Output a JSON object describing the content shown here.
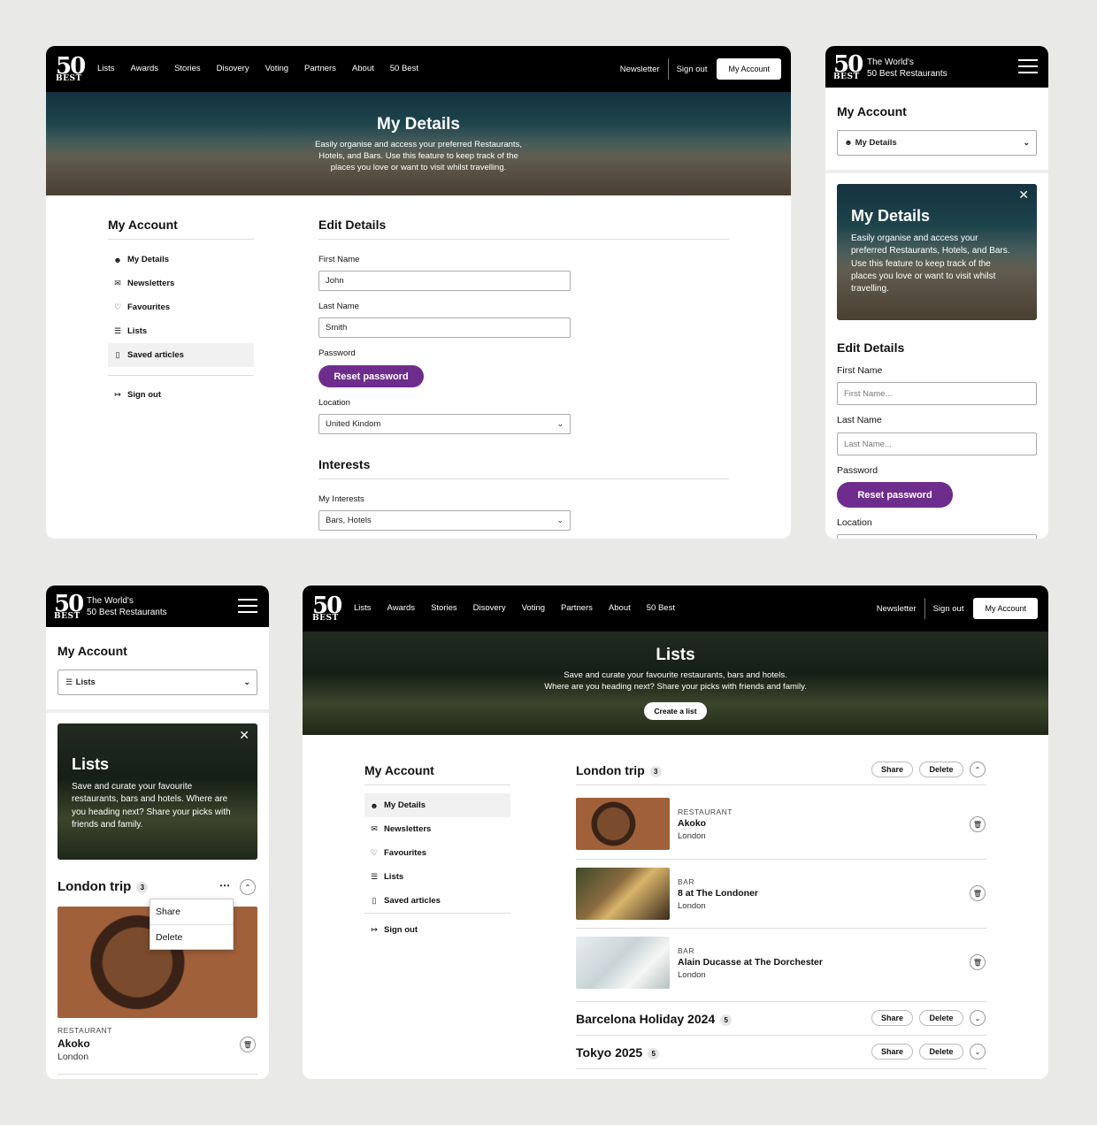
{
  "brand": {
    "fifty": "50",
    "best": "BEST",
    "name_line1": "The World's",
    "name_line2": "50 Best Restaurants"
  },
  "nav": {
    "links": [
      "Lists",
      "Awards",
      "Stories",
      "Disovery",
      "Voting",
      "Partners",
      "About",
      "50 Best"
    ],
    "newsletter": "Newsletter",
    "signout": "Sign out",
    "account": "My Account"
  },
  "sidebar": {
    "title": "My Account",
    "items": [
      {
        "label": "My Details",
        "icon": "user-icon"
      },
      {
        "label": "Newsletters",
        "icon": "mail-icon"
      },
      {
        "label": "Favourites",
        "icon": "heart-icon"
      },
      {
        "label": "Lists",
        "icon": "list-icon"
      },
      {
        "label": "Saved articles",
        "icon": "bookmark-icon"
      }
    ],
    "signout": "Sign out"
  },
  "details": {
    "hero_title": "My Details",
    "hero_text_1": "Easily organise and access your preferred Restaurants,",
    "hero_text_2": "Hotels, and Bars. Use this feature to keep track of the",
    "hero_text_3": "places you love or want to visit whilst travelling.",
    "mobile_hero_lines": [
      "Easily organise and access your",
      "preferred Restaurants, Hotels, and Bars.",
      "Use this feature to keep track of the",
      "places you love or want to visit whilst",
      "travelling."
    ],
    "edit_title": "Edit Details",
    "first_name_label": "First Name",
    "first_name_value": "John",
    "first_name_placeholder": "First Name...",
    "last_name_label": "Last Name",
    "last_name_value": "Smith",
    "last_name_placeholder": "Last Name...",
    "password_label": "Password",
    "reset_button": "Reset password",
    "location_label": "Location",
    "location_value": "United Kindom",
    "interests_title": "Interests",
    "my_interests_label": "My Interests",
    "my_interests_value": "Bars, Hotels",
    "mobile_select": "My Details"
  },
  "lists": {
    "hero_title": "Lists",
    "hero_text_1": "Save and curate your favourite restaurants, bars and hotels.",
    "hero_text_2": "Where are you heading  next? Share your picks with friends and family.",
    "mobile_hero_lines": [
      "Save and curate your favourite",
      "restaurants, bars and hotels.  Where are",
      "you heading  next? Share your picks with",
      "friends and family."
    ],
    "create_button": "Create a list",
    "mobile_select": "Lists",
    "share": "Share",
    "delete": "Delete",
    "groups": [
      {
        "name": "London trip",
        "count": "3"
      },
      {
        "name": "Barcelona Holiday 2024",
        "count": "5"
      },
      {
        "name": "Tokyo 2025",
        "count": "5"
      }
    ],
    "items": [
      {
        "type": "RESTAURANT",
        "name": "Akoko",
        "city": "London"
      },
      {
        "type": "BAR",
        "name": "8 at The Londoner",
        "city": "London"
      },
      {
        "type": "BAR",
        "name": "Alain Ducasse at The Dorchester",
        "city": "London"
      }
    ]
  }
}
